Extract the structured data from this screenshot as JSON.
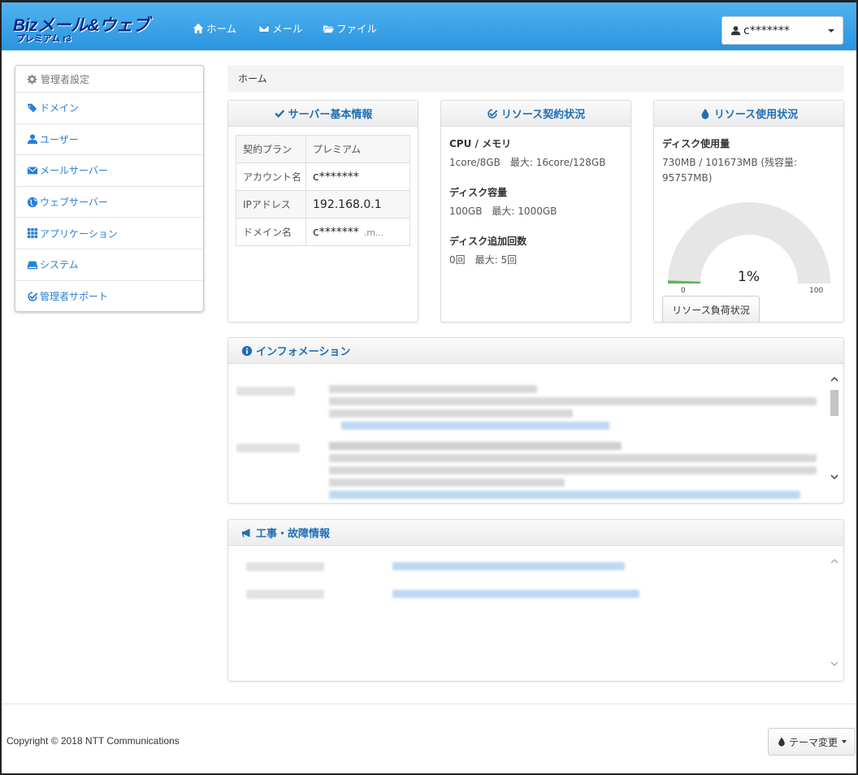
{
  "brand": {
    "line1": "Bizメール&ウェブ",
    "line2": "プレミアム r3"
  },
  "nav": {
    "home": "ホーム",
    "mail": "メール",
    "file": "ファイル"
  },
  "user": {
    "name": "c*******"
  },
  "sidebar": {
    "header": "管理者設定",
    "items": [
      {
        "label": "ドメイン",
        "icon": "tags-icon"
      },
      {
        "label": "ユーザー",
        "icon": "user-icon"
      },
      {
        "label": "メールサーバー",
        "icon": "envelope-icon"
      },
      {
        "label": "ウェブサーバー",
        "icon": "globe-icon"
      },
      {
        "label": "アプリケーション",
        "icon": "grid-icon"
      },
      {
        "label": "システム",
        "icon": "hdd-icon"
      },
      {
        "label": "管理者サポート",
        "icon": "check-square-icon"
      }
    ]
  },
  "breadcrumb": "ホーム",
  "server_panel": {
    "title": "サーバー基本情報",
    "rows": [
      {
        "key": "契約プラン",
        "value": "プレミアム",
        "extra": ""
      },
      {
        "key": "アカウント名",
        "value": "c*******",
        "extra": ""
      },
      {
        "key": "IPアドレス",
        "value": "192.168.0.1",
        "extra": ""
      },
      {
        "key": "ドメイン名",
        "value": "c*******",
        "extra": ".m..."
      }
    ]
  },
  "contract_panel": {
    "title": "リソース契約状況",
    "cpu_label": "CPU / メモリ",
    "cpu_value": "1core/8GB　最大: 16core/128GB",
    "disk_label": "ディスク容量",
    "disk_value": "100GB　最大: 1000GB",
    "disk_add_label": "ディスク追加回数",
    "disk_add_value": "0回　最大: 5回"
  },
  "usage_panel": {
    "title": "リソース使用状況",
    "disk_label": "ディスク使用量",
    "disk_value": "730MB / 101673MB (残容量: 95757MB)",
    "gauge_value": "1%",
    "gauge_percent": 1,
    "gauge_min": "0",
    "gauge_max": "100",
    "load_button": "リソース負荷状況"
  },
  "info_panel": {
    "title": "インフォメーション"
  },
  "maintenance_panel": {
    "title": "工事・故障情報"
  },
  "footer": {
    "copyright": "Copyright © 2018 NTT Communications",
    "theme_button": "テーマ変更"
  },
  "colors": {
    "nav_top": "#4fb3ef",
    "nav_bottom": "#2b94e0",
    "link": "#2a7fd4",
    "panel_title": "#1f6fb5",
    "gauge_fill": "#5cb85c",
    "gauge_bg": "#e6e6e6"
  }
}
